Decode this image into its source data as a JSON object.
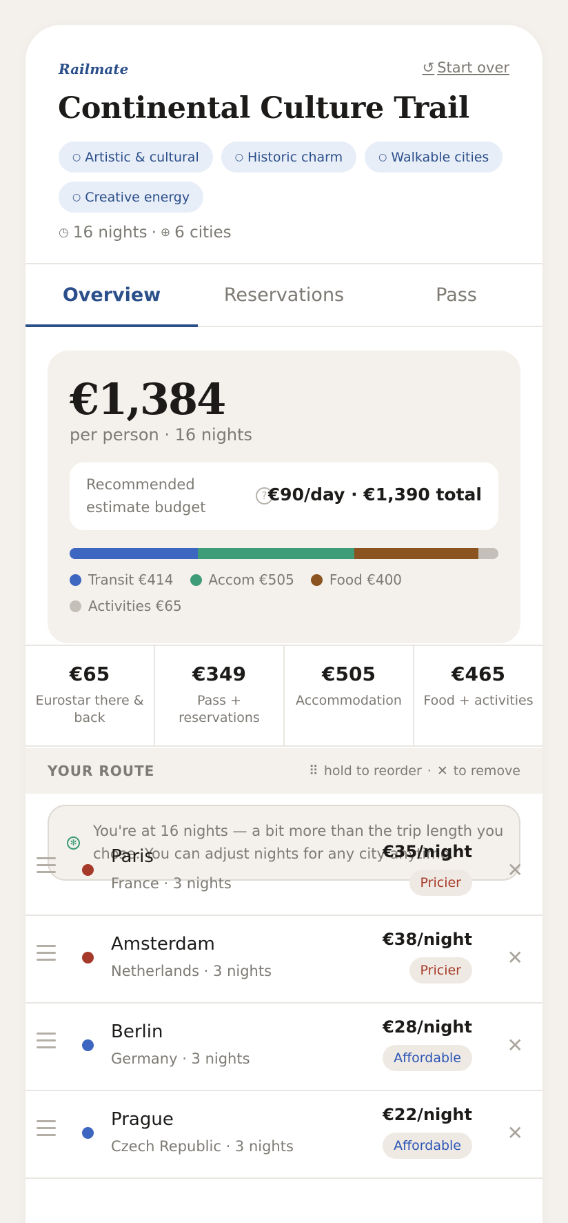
{
  "app": {
    "brand": "Railmate",
    "start_over": "Start over",
    "start_over_icon": "refresh-icon"
  },
  "trip": {
    "title": "Continental Culture Trail",
    "tags": [
      "Artistic & cultural",
      "Historic charm",
      "Walkable cities",
      "Creative energy"
    ],
    "nights_text": "16 nights",
    "cities_text": "6 cities",
    "separator": "·"
  },
  "tabs": [
    {
      "label": "Overview",
      "active": true
    },
    {
      "label": "Reservations",
      "active": false
    },
    {
      "label": "Pass",
      "active": false
    }
  ],
  "budget": {
    "price": "€1,384",
    "per": "per person · 16 nights",
    "rec_label": "Recommended estimate budget",
    "rec_value": "€90/day · €1,390 total",
    "breakdown": [
      {
        "label": "Transit €414",
        "value": 414,
        "color": "#3c66c0"
      },
      {
        "label": "Accom €505",
        "value": 505,
        "color": "#3f9c78"
      },
      {
        "label": "Food €400",
        "value": 400,
        "color": "#8a5320"
      },
      {
        "label": "Activities €65",
        "value": 65,
        "color": "#c4c0b9"
      }
    ]
  },
  "stats": [
    {
      "value": "€65",
      "label": "Eurostar there & back"
    },
    {
      "value": "€349",
      "label": "Pass + reservations"
    },
    {
      "value": "€505",
      "label": "Accommodation"
    },
    {
      "value": "€465",
      "label": "Food + activities"
    }
  ],
  "route": {
    "title": "YOUR ROUTE",
    "hint_reorder": "hold to reorder",
    "hint_sep": "·",
    "hint_remove": "to remove",
    "notice": "You're at 16 nights — a bit more than the trip length you chose. You can adjust nights for any city anytime.",
    "cities": [
      {
        "name": "Paris",
        "sub": "France · 3 nights",
        "nightly": "€35/night",
        "badge": "Pricier",
        "dot": "#a63a2a",
        "badge_color": "#a63a2a"
      },
      {
        "name": "Amsterdam",
        "sub": "Netherlands · 3 nights",
        "nightly": "€38/night",
        "badge": "Pricier",
        "dot": "#a63a2a",
        "badge_color": "#a63a2a"
      },
      {
        "name": "Berlin",
        "sub": "Germany · 3 nights",
        "nightly": "€28/night",
        "badge": "Affordable",
        "dot": "#3c66c0",
        "badge_color": "#2b55b5"
      },
      {
        "name": "Prague",
        "sub": "Czech Republic · 3 nights",
        "nightly": "€22/night",
        "badge": "Affordable",
        "dot": "#3c66c0",
        "badge_color": "#2b55b5"
      }
    ]
  }
}
